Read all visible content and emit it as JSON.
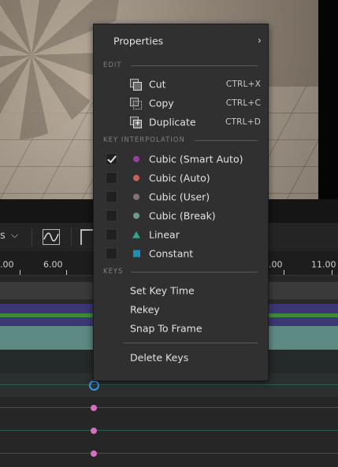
{
  "context_menu": {
    "properties": {
      "label": "Properties"
    },
    "sections": {
      "edit": "EDIT",
      "key_interpolation": "KEY INTERPOLATION",
      "keys": "KEYS"
    },
    "edit_items": [
      {
        "label": "Cut",
        "shortcut": "CTRL+X",
        "icon": "cut-icon"
      },
      {
        "label": "Copy",
        "shortcut": "CTRL+C",
        "icon": "copy-icon"
      },
      {
        "label": "Duplicate",
        "shortcut": "CTRL+D",
        "icon": "duplicate-icon"
      }
    ],
    "interpolation_items": [
      {
        "label": "Cubic (Smart Auto)",
        "checked": true,
        "color": "#9a3fa0",
        "icon": "dot"
      },
      {
        "label": "Cubic (Auto)",
        "checked": false,
        "color": "#c8605e",
        "icon": "dot"
      },
      {
        "label": "Cubic (User)",
        "checked": false,
        "color": "#86707e",
        "icon": "dot"
      },
      {
        "label": "Cubic (Break)",
        "checked": false,
        "color": "#6f9b86",
        "icon": "dot"
      },
      {
        "label": "Linear",
        "checked": false,
        "color": "#2fa58e",
        "icon": "triangle"
      },
      {
        "label": "Constant",
        "checked": false,
        "color": "#1d8fb3",
        "icon": "square"
      }
    ],
    "key_items": [
      {
        "label": "Set Key Time"
      },
      {
        "label": "Rekey"
      },
      {
        "label": "Snap To Frame"
      }
    ],
    "delete": {
      "label": "Delete Keys"
    }
  },
  "toolbar": {
    "partial_label": "s"
  },
  "ruler": {
    "labels": [
      ".00",
      "6.00",
      ".00",
      "11.00"
    ]
  }
}
